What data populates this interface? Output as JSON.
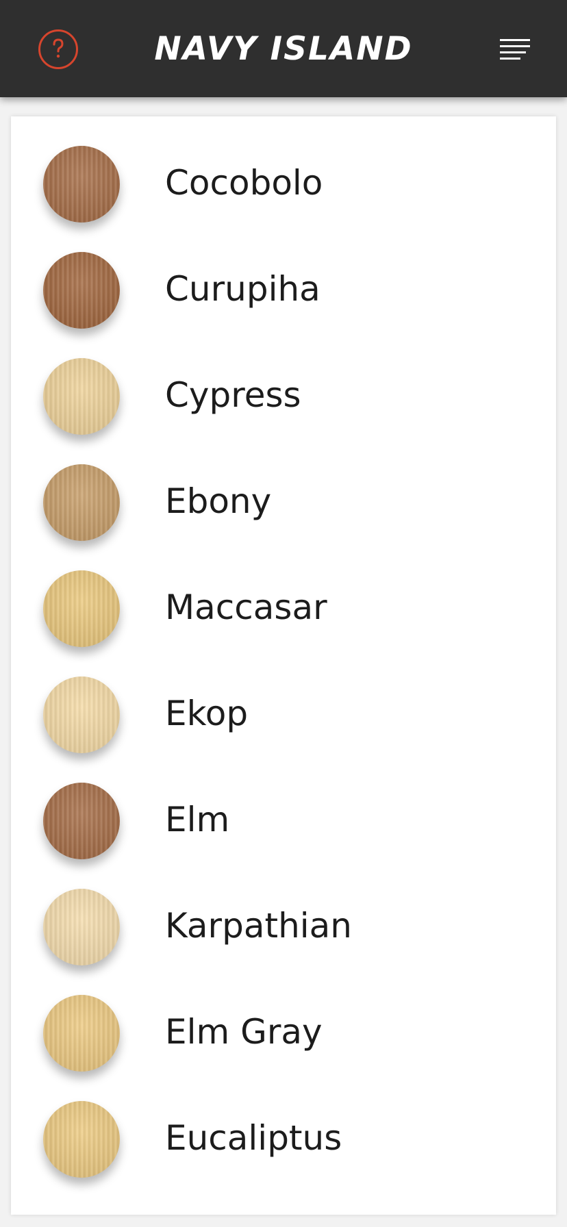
{
  "header": {
    "brand": "NAVY ISLAND",
    "help_icon": "help-circle-icon",
    "menu_icon": "menu-icon",
    "help_color": "#d6452d",
    "background": "#2f2f2f"
  },
  "wood_list": [
    {
      "name": "Cocobolo",
      "color": "#a8704a"
    },
    {
      "name": "Curupiha",
      "color": "#a46a42"
    },
    {
      "name": "Cypress",
      "color": "#f0d49c"
    },
    {
      "name": "Ebony",
      "color": "#c9a06c"
    },
    {
      "name": "Maccasar",
      "color": "#ecca80"
    },
    {
      "name": "Ekop",
      "color": "#f6dca8"
    },
    {
      "name": "Elm",
      "color": "#a8704a"
    },
    {
      "name": "Karpathian",
      "color": "#f6deaf"
    },
    {
      "name": "Elm Gray",
      "color": "#eecb84"
    },
    {
      "name": "Eucaliptus",
      "color": "#eecc84"
    }
  ]
}
